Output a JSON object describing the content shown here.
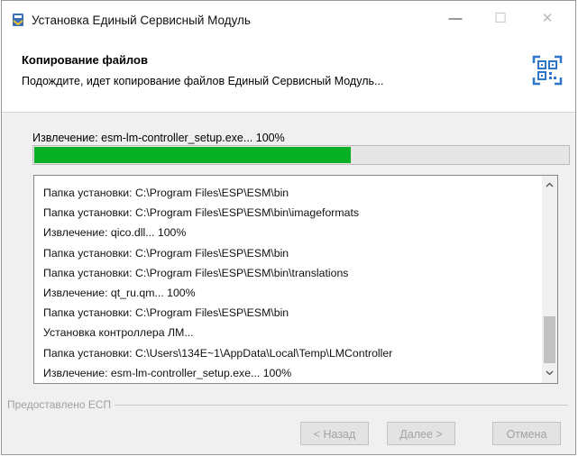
{
  "window": {
    "title": "Установка Единый Сервисный Модуль",
    "controls": {
      "minimize": "—",
      "maximize": "☐",
      "close": "✕"
    }
  },
  "header": {
    "title": "Копирование файлов",
    "subtitle": "Подождите, идет копирование файлов Единый Сервисный Модуль..."
  },
  "progress": {
    "status_text": "Извлечение: esm-lm-controller_setup.exe... 100%",
    "fraction": 0.595,
    "color": "#06b025"
  },
  "log": {
    "lines": [
      "Папка установки: C:\\Program Files\\ESP\\ESM\\bin",
      "Папка установки: C:\\Program Files\\ESP\\ESM\\bin\\imageformats",
      "Извлечение: qico.dll... 100%",
      "Папка установки: C:\\Program Files\\ESP\\ESM\\bin",
      "Папка установки: C:\\Program Files\\ESP\\ESM\\bin\\translations",
      "Извлечение: qt_ru.qm... 100%",
      "Папка установки: C:\\Program Files\\ESP\\ESM\\bin",
      "Установка контроллера ЛМ...",
      "Папка установки: C:\\Users\\134E~1\\AppData\\Local\\Temp\\LMController",
      "Извлечение: esm-lm-controller_setup.exe... 100%"
    ]
  },
  "footer": {
    "provided_by": "Предоставлено ЕСП",
    "back_label": "< Назад",
    "next_label": "Далее >",
    "cancel_label": "Отмена"
  }
}
